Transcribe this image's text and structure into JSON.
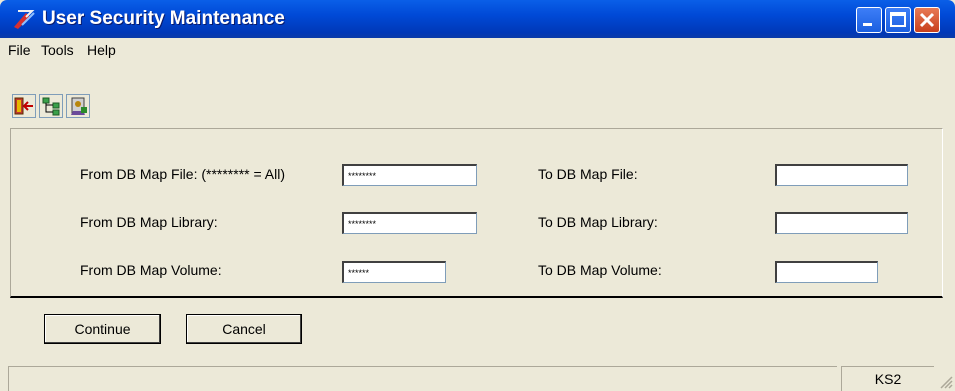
{
  "window": {
    "title": "User Security Maintenance"
  },
  "menu": {
    "items": [
      "File",
      "Tools",
      "Help"
    ]
  },
  "toolbar": {
    "icons": [
      "exit-icon",
      "tree-icon",
      "security-icon"
    ]
  },
  "form": {
    "from_file_label": "From DB Map File: (******** = All)",
    "from_file_value": "********",
    "from_library_label": "From DB Map Library:",
    "from_library_value": "********",
    "from_volume_label": "From DB Map Volume:",
    "from_volume_value": "******",
    "to_file_label": "To DB Map File:",
    "to_file_value": "",
    "to_library_label": "To DB Map Library:",
    "to_library_value": "",
    "to_volume_label": "To DB Map Volume:",
    "to_volume_value": ""
  },
  "buttons": {
    "continue": "Continue",
    "cancel": "Cancel"
  },
  "status": {
    "cell": "KS2"
  },
  "colors": {
    "titlebar": "#0049d6",
    "face": "#ece9d8",
    "close": "#c8401d"
  }
}
